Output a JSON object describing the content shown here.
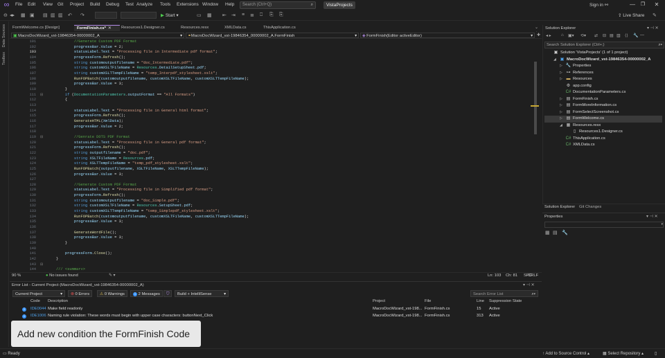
{
  "app": {
    "menu": [
      "File",
      "Edit",
      "View",
      "Git",
      "Project",
      "Build",
      "Debug",
      "Test",
      "Analyze",
      "Tools",
      "Extensions",
      "Window",
      "Help"
    ],
    "search_placeholder": "Search (Ctrl+Q)",
    "solution_name": "VistaProjects",
    "sign_in": "Sign in",
    "live_share": "Live Share",
    "start_label": "Start"
  },
  "tabs": [
    {
      "label": "FormWelcome.cs [Design]",
      "active": false
    },
    {
      "label": "FormFinish.cs*",
      "active": true
    },
    {
      "label": "Resources1.Designer.cs",
      "active": false
    },
    {
      "label": "Resources.resx",
      "active": false
    },
    {
      "label": "XMLData.cs",
      "active": false
    },
    {
      "label": "ThisApplication.cs",
      "active": false
    }
  ],
  "navbar": {
    "project": "MacroDocWizard_vst-19846354-00000002_A",
    "class": "MacroDocWizard_vst-19846354_00000002_A.FormFinish",
    "member": "FormFinish(Editor activeEditor)"
  },
  "editor": {
    "current_line": 103,
    "lines": [
      {
        "n": 101,
        "t": "            //Generate Custom PDF Format"
      },
      {
        "n": 102,
        "t": "            progressBar.Value = 2;"
      },
      {
        "n": 103,
        "t": "            statusLabel.Text = \"Processing file in Intermediate pdf format\";"
      },
      {
        "n": 104,
        "t": "            progressForm.Refresh();"
      },
      {
        "n": 105,
        "t": "            string customoutputfilename = \"doc_Intermediate.pdf\";"
      },
      {
        "n": 106,
        "t": "            string customXSLTFileName = Resources.DetailSetupSheet.pdf;"
      },
      {
        "n": 107,
        "t": "            string customXSLTTempFileName = \"temp_Interpdf_stylesheet.xslt\";"
      },
      {
        "n": 108,
        "t": "            RunFOPBatch(customoutputfilename, customXSLTFileName, customXSLTTempFileName);"
      },
      {
        "n": 109,
        "t": "            progressBar.Value = 3;"
      },
      {
        "n": 110,
        "t": "        }"
      },
      {
        "n": 111,
        "t": "        if (DocumentationParameters.outputFormat == \"All Formats\")"
      },
      {
        "n": 112,
        "t": "        {"
      },
      {
        "n": 113,
        "t": ""
      },
      {
        "n": 114,
        "t": "            statusLabel.Text = \"Processing file in General html format\";"
      },
      {
        "n": 115,
        "t": "            progressForm.Refresh();"
      },
      {
        "n": 116,
        "t": "            GenerateHTML(XmlData);"
      },
      {
        "n": 117,
        "t": "            progressBar.Value = 2;"
      },
      {
        "n": 118,
        "t": ""
      },
      {
        "n": 119,
        "t": "            //Genrate DOTS PDF Format"
      },
      {
        "n": 120,
        "t": "            statusLabel.Text = \"Processing file in General pdf format\";"
      },
      {
        "n": 121,
        "t": "            progressForm.Refresh();"
      },
      {
        "n": 122,
        "t": "            string outputfilename = \"doc.pdf\";"
      },
      {
        "n": 123,
        "t": "            string XSLTFileName = Resources.pdf;"
      },
      {
        "n": 124,
        "t": "            string XSLTTempFileName = \"temp_pdf_stylesheet.xslt\";"
      },
      {
        "n": 125,
        "t": "            RunFOPBatch(outputfilename, XSLTFileName, XSLTTempFileName);"
      },
      {
        "n": 126,
        "t": "            progressBar.Value = 3;"
      },
      {
        "n": 127,
        "t": ""
      },
      {
        "n": 128,
        "t": "            //Generate Custom PDF Format"
      },
      {
        "n": 129,
        "t": "            statusLabel.Text = \"Processing file in Simplified pdf format\";"
      },
      {
        "n": 130,
        "t": "            progressForm.Refresh();"
      },
      {
        "n": 131,
        "t": "            string customoutputfilename = \"doc_Simple.pdf\";"
      },
      {
        "n": 132,
        "t": "            string customXSLTFileName = Resources.SetupSheet.pdf;"
      },
      {
        "n": 133,
        "t": "            string customXSLTTempFileName = \"temp_Simplepdf_stylesheet.xslt\";"
      },
      {
        "n": 134,
        "t": "            RunFOPBatch(customoutputfilename, customXSLTFileName, customXSLTTempFileName);"
      },
      {
        "n": 135,
        "t": "            progressBar.Value = 3;"
      },
      {
        "n": 136,
        "t": ""
      },
      {
        "n": 137,
        "t": "            GenerateWordFile();"
      },
      {
        "n": 138,
        "t": "            progressBar.Value = 3;"
      },
      {
        "n": 139,
        "t": "        }"
      },
      {
        "n": 140,
        "t": ""
      },
      {
        "n": 141,
        "t": "        progressForm.Close();"
      },
      {
        "n": 142,
        "t": "    }"
      },
      {
        "n": 143,
        "t": ""
      },
      {
        "n": 144,
        "t": "    /// <summary>"
      },
      {
        "n": 145,
        "t": "    /// Transform XML file with XLST in resource and save the output on disk."
      }
    ]
  },
  "editor_status": {
    "zoom": "90 %",
    "issues": "No issues found",
    "position": "Ln: 103",
    "column": "Ch: 81",
    "whitespace": "SPC",
    "line_ending": "CRLF"
  },
  "error_list": {
    "title": "Error List - Current Project (MacroDocWizard_vst-19846354-00000002_A)",
    "scope": "Current Project",
    "errors": "0 Errors",
    "warnings": "0 Warnings",
    "messages": "2 Messages",
    "build_filter": "Build + IntelliSense",
    "search_placeholder": "Search Error List",
    "columns": [
      "Code",
      "Description",
      "Project",
      "File",
      "Line",
      "Suppression State"
    ],
    "rows": [
      {
        "code": "IDE0044",
        "description": "Make field readonly",
        "project": "MacroDocWizard_vst-198...",
        "file": "FormFinish.cs",
        "line": "15",
        "state": "Active"
      },
      {
        "code": "IDE1006",
        "description": "Naming rule violation: These words must begin with upper case characters: buttonNext_Click",
        "project": "MacroDocWizard_vst-198...",
        "file": "FormFinish.cs",
        "line": "313",
        "state": "Active"
      }
    ]
  },
  "tooltip": "Add new condition the FormFinish Code",
  "status_bar": {
    "ready": "Ready",
    "source_control": "Add to Source Control",
    "repository": "Select Repository"
  },
  "solution_explorer": {
    "title": "Solution Explorer",
    "search_placeholder": "Search Solution Explorer (Ctrl+;)",
    "items": [
      {
        "label": "Solution 'VistaProjects' (1 of 1 project)",
        "depth": 0,
        "expander": "",
        "icon": "▣",
        "color": "#ccc"
      },
      {
        "label": "MacroDocWizard_vst-19846354-00000002_A",
        "depth": 1,
        "expander": "◢",
        "icon": "▣",
        "color": "#4ea0e8",
        "bold": true
      },
      {
        "label": "Properties",
        "depth": 2,
        "expander": "▷",
        "icon": "🔧",
        "color": "#ccc"
      },
      {
        "label": "References",
        "depth": 2,
        "expander": "▷",
        "icon": "⊶",
        "color": "#ccc"
      },
      {
        "label": "Resources",
        "depth": 2,
        "expander": "▷",
        "icon": "▬",
        "color": "#dcb862"
      },
      {
        "label": "app.config",
        "depth": 2,
        "expander": "",
        "icon": "⚙",
        "color": "#ccc"
      },
      {
        "label": "DocumentationParameters.cs",
        "depth": 2,
        "expander": "",
        "icon": "C#",
        "color": "#66b066"
      },
      {
        "label": "FormFinish.cs",
        "depth": 2,
        "expander": "▷",
        "icon": "▤",
        "color": "#ccc"
      },
      {
        "label": "FormMoreInformation.cs",
        "depth": 2,
        "expander": "▷",
        "icon": "▤",
        "color": "#ccc"
      },
      {
        "label": "FormSelectScreenshot.cs",
        "depth": 2,
        "expander": "▷",
        "icon": "▤",
        "color": "#ccc"
      },
      {
        "label": "FormWelcome.cs",
        "depth": 2,
        "expander": "▷",
        "icon": "▤",
        "color": "#ccc",
        "selected": true
      },
      {
        "label": "Resources.resx",
        "depth": 2,
        "expander": "◢",
        "icon": "▦",
        "color": "#ccc"
      },
      {
        "label": "Resources1.Designer.cs",
        "depth": 3,
        "expander": "",
        "icon": "▯",
        "color": "#ccc"
      },
      {
        "label": "ThisApplication.cs",
        "depth": 2,
        "expander": "",
        "icon": "C#",
        "color": "#66b066"
      },
      {
        "label": "XMLData.cs",
        "depth": 2,
        "expander": "",
        "icon": "C#",
        "color": "#66b066"
      }
    ],
    "bottom_tabs": [
      "Solution Explorer",
      "Git Changes"
    ]
  },
  "properties": {
    "title": "Properties"
  },
  "left_strip": [
    "Data Sources",
    "Toolbox"
  ],
  "colors": {
    "keyword": "#569cd6",
    "type": "#4ec9b0",
    "string": "#d69d85",
    "comment": "#57a64a",
    "method": "#dcdcaa",
    "accent": "#b48ce8"
  }
}
